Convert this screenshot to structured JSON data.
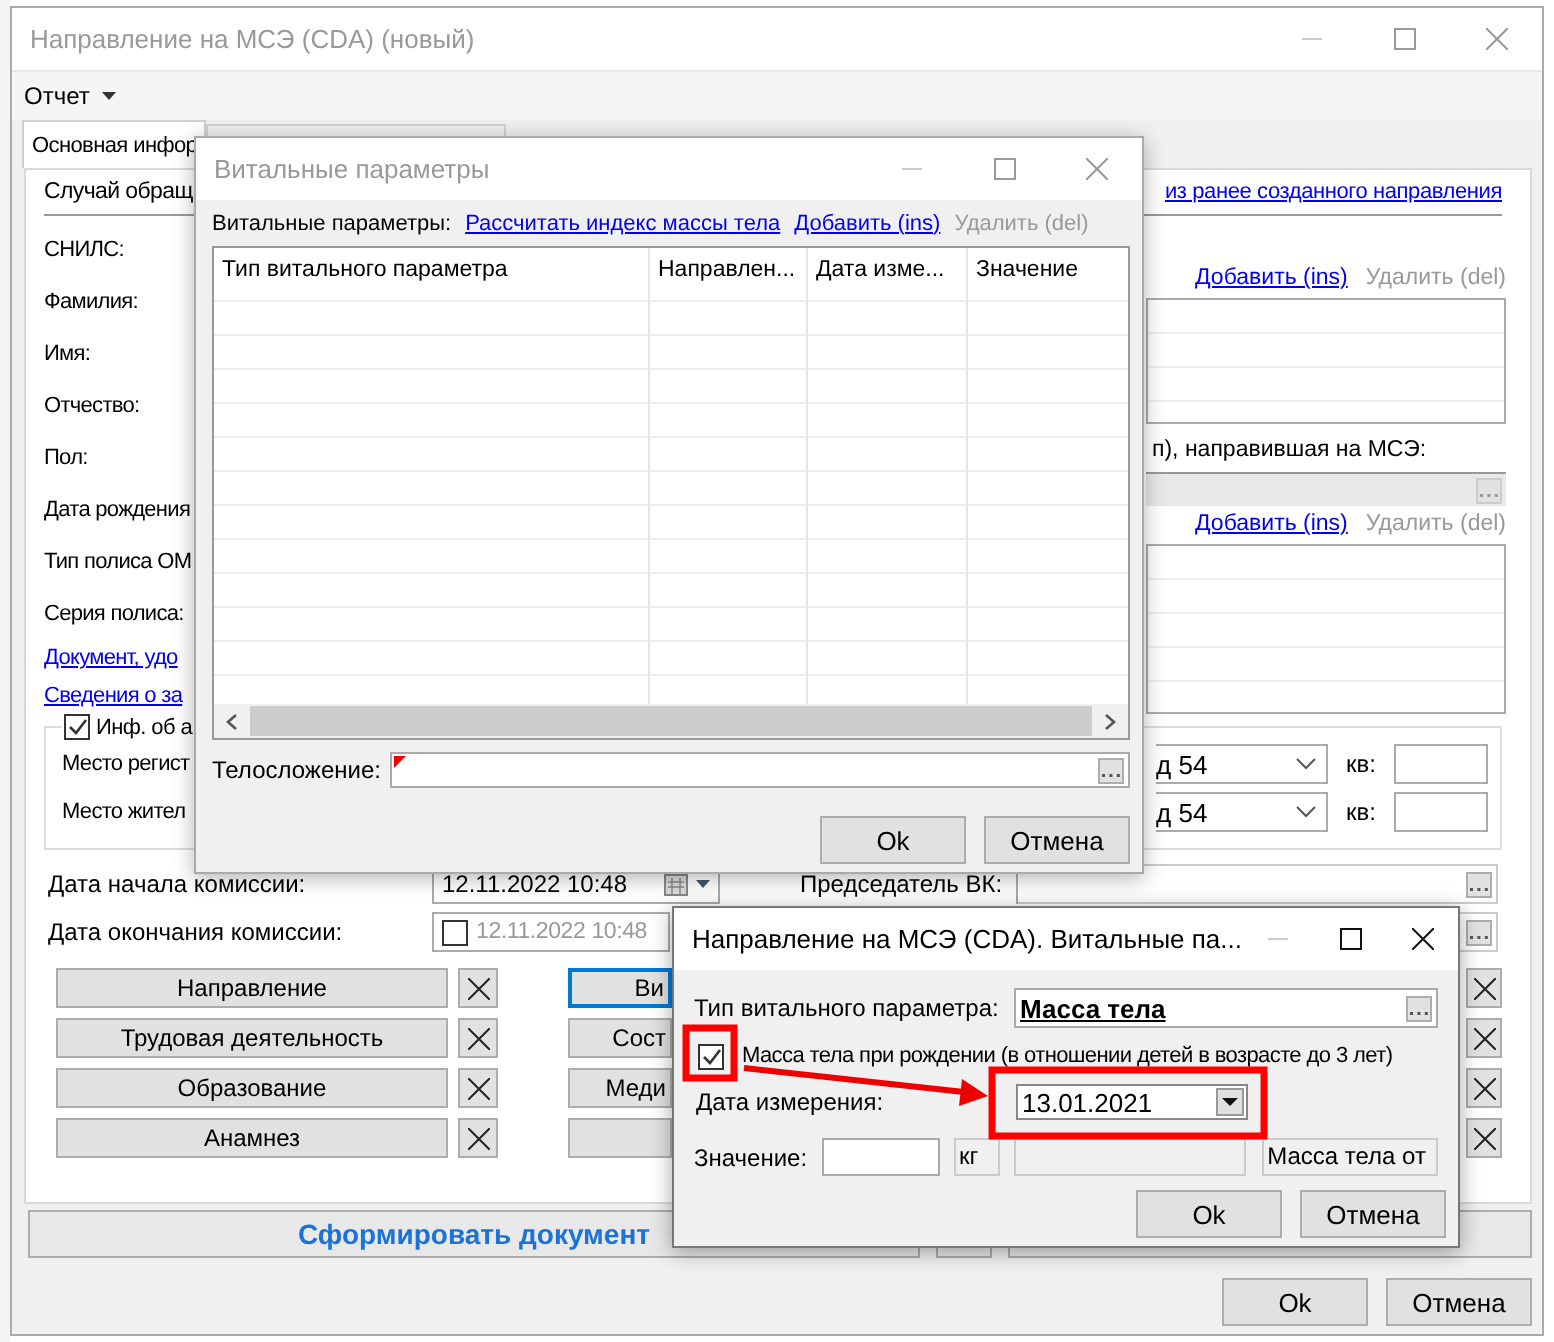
{
  "main_window": {
    "title": "Направление на МСЭ (CDA) (новый)",
    "menu": [
      {
        "label": "Отчет"
      }
    ],
    "tabs": [
      {
        "label": "Основная инфор",
        "selected": true
      },
      {
        "selected": false
      }
    ],
    "case_heading": "Случай обращ",
    "copy_link": "из ранее созданного направления",
    "patient_fields": [
      {
        "kind": "label",
        "text": "СНИЛС:"
      },
      {
        "kind": "label",
        "text": "Фамилия:"
      },
      {
        "kind": "label",
        "text": "Имя:"
      },
      {
        "kind": "label",
        "text": "Отчество:"
      },
      {
        "kind": "label",
        "text": "Пол:"
      },
      {
        "kind": "label",
        "text": "Дата рождения"
      },
      {
        "kind": "label",
        "text": "Тип полиса ОМ"
      },
      {
        "kind": "label",
        "text": "Серия полиса:"
      },
      {
        "kind": "link",
        "text": "Документ, удо"
      },
      {
        "kind": "link",
        "text": "Сведения о за"
      }
    ],
    "grid_1": {
      "actions": [
        {
          "label": "Добавить (ins)",
          "disabled": false
        },
        {
          "label": "Удалить (del)",
          "disabled": true
        }
      ]
    },
    "sender_label": "п), направившая на МСЭ:",
    "grid_2": {
      "actions": [
        {
          "label": "Добавить (ins)",
          "disabled": false
        },
        {
          "label": "Удалить (del)",
          "disabled": true
        }
      ]
    },
    "address": {
      "checkbox": {
        "label": "Инф. об а",
        "checked": true
      },
      "rows": [
        {
          "label": "Место регист",
          "value": "д 54",
          "apt_label": "кв:"
        },
        {
          "label": "Место жител",
          "value": "д 54",
          "apt_label": "кв:"
        }
      ]
    },
    "commission_start": {
      "label": "Дата начала комиссии:",
      "value": "12.11.2022 10:48"
    },
    "commission_end": {
      "label": "Дата окончания комиссии:",
      "value": "12.11.2022 10:48",
      "checked": false
    },
    "chairman_label": "Председатель ВК:",
    "section_buttons": [
      {
        "label": "Направление"
      },
      {
        "label": "Трудовая деятельность"
      },
      {
        "label": "Образование"
      },
      {
        "label": "Анамнез"
      }
    ],
    "section_buttons_2": [
      {
        "label": "Ви",
        "focused": true
      },
      {
        "label": "Сост",
        "focused": false
      },
      {
        "label": "Меди",
        "focused": false
      },
      {
        "focused": false
      }
    ],
    "generate_button": "Сформировать документ",
    "footer_buttons": [
      "Ok",
      "Отмена"
    ]
  },
  "vital_dialog": {
    "title": "Витальные параметры",
    "toolbar_label": "Витальные параметры:",
    "actions": [
      {
        "label": "Рассчитать индекс массы тела",
        "disabled": false
      },
      {
        "label": "Добавить (ins)",
        "disabled": false
      },
      {
        "label": "Удалить (del)",
        "disabled": true
      }
    ],
    "table": {
      "columns": [
        "Тип витального параметра",
        "Направлен...",
        "Дата изме...",
        "Значение"
      ]
    },
    "body_type": {
      "label": "Телосложение:",
      "required": true
    },
    "buttons": [
      "Ok",
      "Отмена"
    ]
  },
  "vital_edit_dialog": {
    "title": "Направление на МСЭ (CDA). Витальные па...",
    "type": {
      "label": "Тип витального параметра:",
      "value": "Масса тела"
    },
    "birth_weight": {
      "label": "Масса тела при рождении (в отношении детей в возрасте до 3 лет)",
      "checked": true
    },
    "date": {
      "label": "Дата измерения:",
      "value": "13.01.2021"
    },
    "value": {
      "label": "Значение:",
      "unit": "кг",
      "hint": "Масса тела от"
    },
    "buttons": [
      "Ok",
      "Отмена"
    ]
  }
}
